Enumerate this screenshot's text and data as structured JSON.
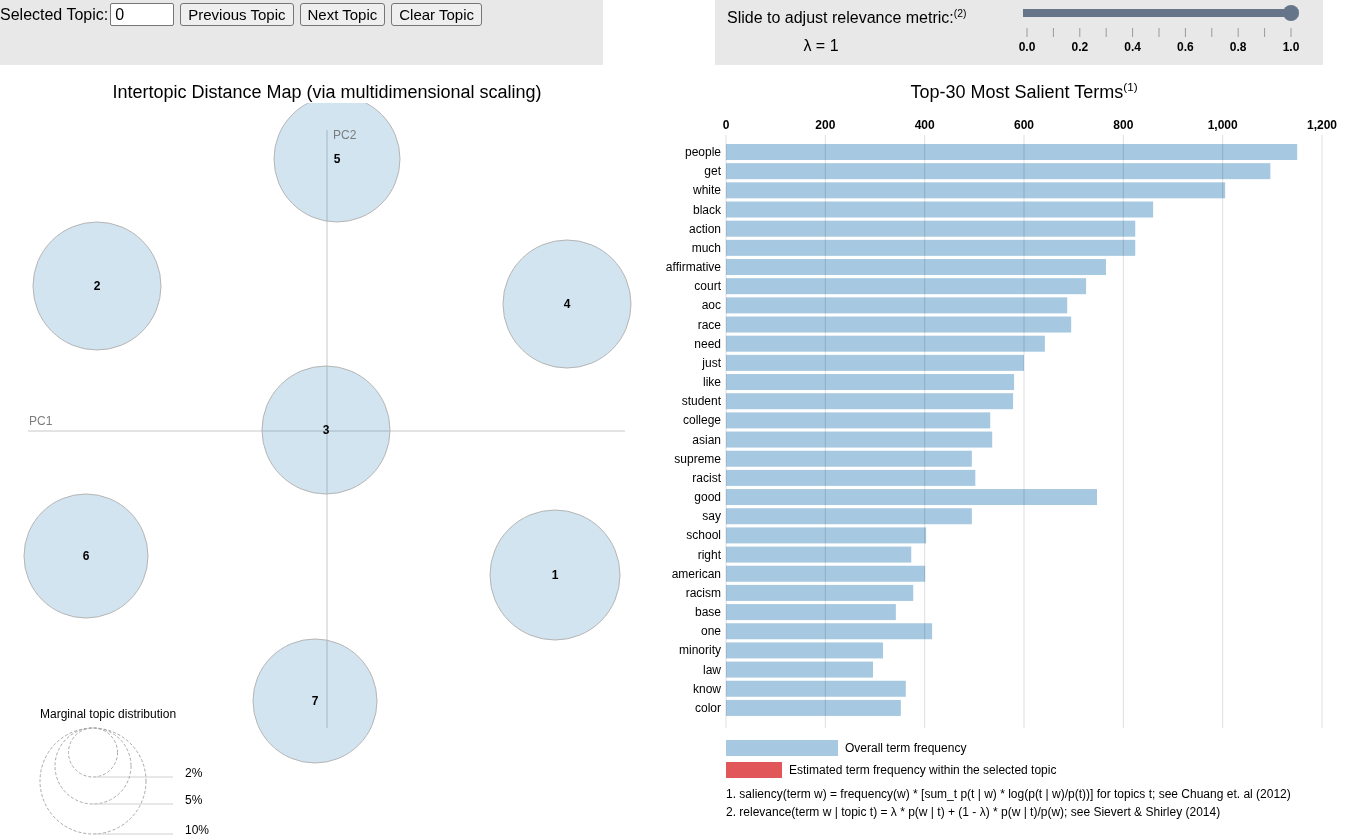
{
  "topic_selector": {
    "label": "Selected Topic:",
    "value": "0",
    "buttons": [
      "Previous Topic",
      "Next Topic",
      "Clear Topic"
    ]
  },
  "relevance_slider": {
    "label": "Slide to adjust relevance metric:$^{(2)}$",
    "lambda_text": "λ = 1",
    "level": 1,
    "ticks": [
      "0.0",
      "0.2",
      "0.4",
      "0.6",
      "0.8",
      "1.0"
    ]
  },
  "topic_map": {
    "title": "Intertopic Distance Map (via multidimensional scaling)",
    "x_axis_label": "PC1",
    "y_axis_label": "PC2",
    "topics": [
      {
        "label": "1"
      },
      {
        "label": "2"
      },
      {
        "label": "3"
      },
      {
        "label": "4"
      },
      {
        "label": "5"
      },
      {
        "label": "6"
      },
      {
        "label": "7"
      }
    ],
    "size_legend": {
      "title": "Marginal topic distribution",
      "labels": [
        "2%",
        "5%",
        "10%"
      ]
    }
  },
  "term_chart": {
    "title": "Top-30 Most Salient Terms$^{(1)}$",
    "chart_data": {
      "type": "bar",
      "orientation": "horizontal",
      "categories": [
        "people",
        "get",
        "white",
        "black",
        "action",
        "much",
        "affirmative",
        "court",
        "aoc",
        "race",
        "need",
        "just",
        "like",
        "student",
        "college",
        "asian",
        "supreme",
        "racist",
        "good",
        "say",
        "school",
        "right",
        "american",
        "racism",
        "base",
        "one",
        "minority",
        "law",
        "know",
        "color"
      ],
      "series": [
        {
          "name": "Overall term frequency",
          "color": "#a6c8e0",
          "values": [
            1150,
            1096,
            1005,
            860,
            824,
            824,
            765,
            725,
            687,
            695,
            642,
            600,
            580,
            578,
            532,
            536,
            495,
            502,
            747,
            495,
            403,
            373,
            401,
            377,
            342,
            415,
            316,
            296,
            362,
            352
          ]
        }
      ],
      "xlim": [
        0,
        1200
      ],
      "xticks": [
        0,
        200,
        400,
        600,
        800,
        {
          "value": 1000,
          "label": "1,000"
        },
        {
          "value": 1200,
          "label": "1,200"
        }
      ],
      "grid": true
    },
    "topic_legend": {
      "label": "Estimated term frequency within the selected topic",
      "color": "#e15759"
    },
    "footnotes": [
      "1. saliency(term w) = frequency(w) * [sum_t p(t | w) * log(p(t | w)/p(t))] for topics t; see Chuang et. al (2012)",
      "2. relevance(term w | topic t) = λ * p(w | t) + (1 - λ) * p(w | t)/p(w); see Sievert & Shirley (2014)"
    ]
  }
}
